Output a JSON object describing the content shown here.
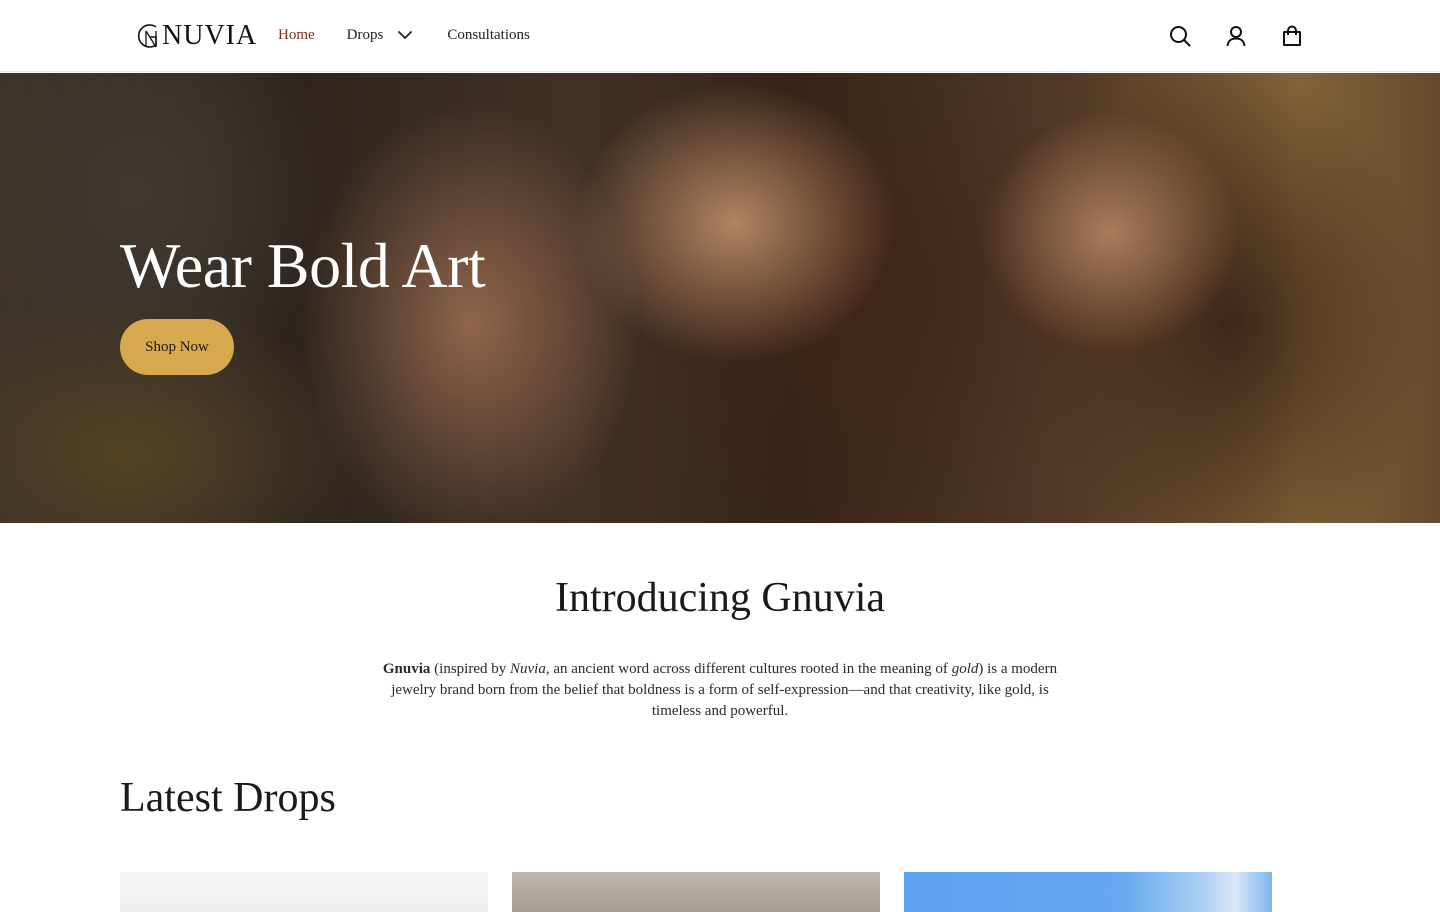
{
  "brand": {
    "logo_text": "NUVIA"
  },
  "nav": {
    "home": "Home",
    "drops": "Drops",
    "consultations": "Consultations"
  },
  "header_icons": [
    "search-icon",
    "account-icon",
    "cart-icon"
  ],
  "hero": {
    "title": "Wear Bold Art",
    "button": "Shop Now"
  },
  "intro": {
    "title": "Introducing Gnuvia",
    "brand_name": "Gnuvia",
    "text_1": " (inspired by ",
    "nuvia": "Nuvia",
    "text_2": ", an ancient word across different cultures rooted in the meaning of ",
    "gold": "gold",
    "text_3": ") is a modern jewelry brand born from the belief that boldness is a form of self-expression—and that creativity, like gold, is timeless and powerful."
  },
  "latest": {
    "title": "Latest Drops"
  },
  "colors": {
    "accent": "#d6a94e",
    "active_nav": "#7a2e22"
  }
}
